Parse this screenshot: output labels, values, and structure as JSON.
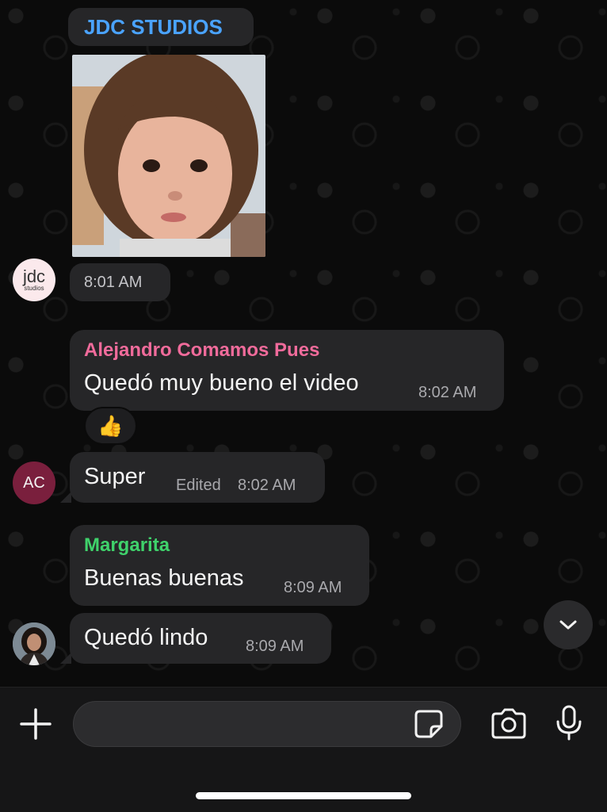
{
  "colors": {
    "bubble": "#262628",
    "jdc_name": "#4aa3ff",
    "alejandro_name": "#f06b9b",
    "margarita_name": "#3fd26b",
    "ac_avatar": "#7a1f3d"
  },
  "messages": {
    "jdc": {
      "sender": "JDC STUDIOS",
      "time": "8:01 AM",
      "image": "photo-of-child"
    },
    "alejandro": {
      "sender": "Alejandro Comamos Pues",
      "text": "Quedó muy bueno el video",
      "time": "8:02 AM",
      "reaction": "👍"
    },
    "ac": {
      "text": "Super",
      "edited": "Edited",
      "time": "8:02 AM",
      "avatar_initials": "AC"
    },
    "margarita": {
      "sender": "Margarita",
      "text": "Buenas buenas",
      "time": "8:09 AM"
    },
    "last": {
      "text": "Quedó lindo",
      "time": "8:09 AM"
    }
  },
  "avatars": {
    "jdc_logo_text": "jdc",
    "jdc_logo_sub": "studios"
  },
  "icons": {
    "scroll_down": "chevron-down-icon",
    "add": "plus-icon",
    "sticker": "sticker-icon",
    "camera": "camera-icon",
    "mic": "microphone-icon"
  }
}
